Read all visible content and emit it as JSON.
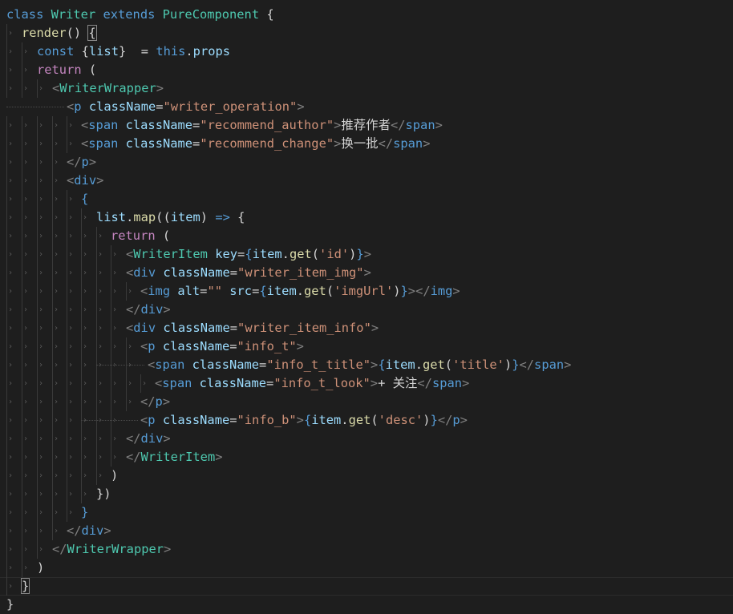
{
  "editor": {
    "theme_background": "#1e1e1e",
    "lines": [
      [
        [
          "kw",
          "class "
        ],
        [
          "cls",
          "Writer "
        ],
        [
          "kw",
          "extends "
        ],
        [
          "cls",
          "PureComponent "
        ],
        [
          "pun",
          "{"
        ]
      ],
      [
        [
          "fn",
          "render"
        ],
        [
          "pun",
          "() "
        ],
        [
          "pun",
          "{"
        ]
      ],
      [
        [
          "kw",
          "const "
        ],
        [
          "pun",
          "{"
        ],
        [
          "var",
          "list"
        ],
        [
          "pun",
          "}  = "
        ],
        [
          "kw",
          "this"
        ],
        [
          "pun",
          "."
        ],
        [
          "var",
          "props"
        ]
      ],
      [
        [
          "ctrl",
          "return "
        ],
        [
          "pun",
          "("
        ]
      ],
      [
        [
          "lt",
          "<"
        ],
        [
          "cls",
          "WriterWrapper"
        ],
        [
          "lt",
          ">"
        ]
      ],
      [
        [
          "lt",
          "<"
        ],
        [
          "tag",
          "p "
        ],
        [
          "attr",
          "className"
        ],
        [
          "pun",
          "="
        ],
        [
          "str",
          "\"writer_operation\""
        ],
        [
          "lt",
          ">"
        ]
      ],
      [
        [
          "lt",
          "<"
        ],
        [
          "tag",
          "span "
        ],
        [
          "attr",
          "className"
        ],
        [
          "pun",
          "="
        ],
        [
          "str",
          "\"recommend_author\""
        ],
        [
          "lt",
          ">"
        ],
        [
          "txt",
          "推荐作者"
        ],
        [
          "lt",
          "</"
        ],
        [
          "tag",
          "span"
        ],
        [
          "lt",
          ">"
        ]
      ],
      [
        [
          "lt",
          "<"
        ],
        [
          "tag",
          "span "
        ],
        [
          "attr",
          "className"
        ],
        [
          "pun",
          "="
        ],
        [
          "str",
          "\"recommend_change\""
        ],
        [
          "lt",
          ">"
        ],
        [
          "txt",
          "换一批"
        ],
        [
          "lt",
          "</"
        ],
        [
          "tag",
          "span"
        ],
        [
          "lt",
          ">"
        ]
      ],
      [
        [
          "lt",
          "</"
        ],
        [
          "tag",
          "p"
        ],
        [
          "lt",
          ">"
        ]
      ],
      [
        [
          "lt",
          "<"
        ],
        [
          "tag",
          "div"
        ],
        [
          "lt",
          ">"
        ]
      ],
      [
        [
          "brc",
          "{"
        ]
      ],
      [
        [
          "var",
          "list"
        ],
        [
          "pun",
          "."
        ],
        [
          "fn",
          "map"
        ],
        [
          "pun",
          "(("
        ],
        [
          "var",
          "item"
        ],
        [
          "pun",
          ") "
        ],
        [
          "kw",
          "=>"
        ],
        [
          "pun",
          " {"
        ]
      ],
      [
        [
          "ctrl",
          "return "
        ],
        [
          "pun",
          "("
        ]
      ],
      [
        [
          "lt",
          "<"
        ],
        [
          "cls",
          "WriterItem "
        ],
        [
          "attr",
          "key"
        ],
        [
          "pun",
          "="
        ],
        [
          "brc",
          "{"
        ],
        [
          "var",
          "item"
        ],
        [
          "pun",
          "."
        ],
        [
          "fn",
          "get"
        ],
        [
          "pun",
          "("
        ],
        [
          "str",
          "'id'"
        ],
        [
          "pun",
          ")"
        ],
        [
          "brc",
          "}"
        ],
        [
          "lt",
          ">"
        ]
      ],
      [
        [
          "lt",
          "<"
        ],
        [
          "tag",
          "div "
        ],
        [
          "attr",
          "className"
        ],
        [
          "pun",
          "="
        ],
        [
          "str",
          "\"writer_item_img\""
        ],
        [
          "lt",
          ">"
        ]
      ],
      [
        [
          "lt",
          "<"
        ],
        [
          "tag",
          "img "
        ],
        [
          "attr",
          "alt"
        ],
        [
          "pun",
          "="
        ],
        [
          "str",
          "\"\" "
        ],
        [
          "attr",
          "src"
        ],
        [
          "pun",
          "="
        ],
        [
          "brc",
          "{"
        ],
        [
          "var",
          "item"
        ],
        [
          "pun",
          "."
        ],
        [
          "fn",
          "get"
        ],
        [
          "pun",
          "("
        ],
        [
          "str",
          "'imgUrl'"
        ],
        [
          "pun",
          ")"
        ],
        [
          "brc",
          "}"
        ],
        [
          "lt",
          "></"
        ],
        [
          "tag",
          "img"
        ],
        [
          "lt",
          ">"
        ]
      ],
      [
        [
          "lt",
          "</"
        ],
        [
          "tag",
          "div"
        ],
        [
          "lt",
          ">"
        ]
      ],
      [
        [
          "lt",
          "<"
        ],
        [
          "tag",
          "div "
        ],
        [
          "attr",
          "className"
        ],
        [
          "pun",
          "="
        ],
        [
          "str",
          "\"writer_item_info\""
        ],
        [
          "lt",
          ">"
        ]
      ],
      [
        [
          "lt",
          "<"
        ],
        [
          "tag",
          "p "
        ],
        [
          "attr",
          "className"
        ],
        [
          "pun",
          "="
        ],
        [
          "str",
          "\"info_t\""
        ],
        [
          "lt",
          ">"
        ]
      ],
      [
        [
          "lt",
          "<"
        ],
        [
          "tag",
          "span "
        ],
        [
          "attr",
          "className"
        ],
        [
          "pun",
          "="
        ],
        [
          "str",
          "\"info_t_title\""
        ],
        [
          "lt",
          ">"
        ],
        [
          "brc",
          "{"
        ],
        [
          "var",
          "item"
        ],
        [
          "pun",
          "."
        ],
        [
          "fn",
          "get"
        ],
        [
          "pun",
          "("
        ],
        [
          "str",
          "'title'"
        ],
        [
          "pun",
          ")"
        ],
        [
          "brc",
          "}"
        ],
        [
          "lt",
          "</"
        ],
        [
          "tag",
          "span"
        ],
        [
          "lt",
          ">"
        ]
      ],
      [
        [
          "lt",
          "<"
        ],
        [
          "tag",
          "span "
        ],
        [
          "attr",
          "className"
        ],
        [
          "pun",
          "="
        ],
        [
          "str",
          "\"info_t_look\""
        ],
        [
          "lt",
          ">"
        ],
        [
          "txt",
          "+ 关注"
        ],
        [
          "lt",
          "</"
        ],
        [
          "tag",
          "span"
        ],
        [
          "lt",
          ">"
        ]
      ],
      [
        [
          "lt",
          "</"
        ],
        [
          "tag",
          "p"
        ],
        [
          "lt",
          ">"
        ]
      ],
      [
        [
          "lt",
          "<"
        ],
        [
          "tag",
          "p "
        ],
        [
          "attr",
          "className"
        ],
        [
          "pun",
          "="
        ],
        [
          "str",
          "\"info_b\""
        ],
        [
          "lt",
          ">"
        ],
        [
          "brc",
          "{"
        ],
        [
          "var",
          "item"
        ],
        [
          "pun",
          "."
        ],
        [
          "fn",
          "get"
        ],
        [
          "pun",
          "("
        ],
        [
          "str",
          "'desc'"
        ],
        [
          "pun",
          ")"
        ],
        [
          "brc",
          "}"
        ],
        [
          "lt",
          "</"
        ],
        [
          "tag",
          "p"
        ],
        [
          "lt",
          ">"
        ]
      ],
      [
        [
          "lt",
          "</"
        ],
        [
          "tag",
          "div"
        ],
        [
          "lt",
          ">"
        ]
      ],
      [
        [
          "lt",
          "</"
        ],
        [
          "cls",
          "WriterItem"
        ],
        [
          "lt",
          ">"
        ]
      ],
      [
        [
          "pun",
          ")"
        ]
      ],
      [
        [
          "pun",
          "})"
        ]
      ],
      [
        [
          "brc",
          "}"
        ]
      ],
      [
        [
          "lt",
          "</"
        ],
        [
          "tag",
          "div"
        ],
        [
          "lt",
          ">"
        ]
      ],
      [
        [
          "lt",
          "</"
        ],
        [
          "cls",
          "WriterWrapper"
        ],
        [
          "lt",
          ">"
        ]
      ],
      [
        [
          "pun",
          ")"
        ]
      ],
      [
        [
          "pun",
          "}"
        ]
      ],
      [
        [
          "pun",
          "}"
        ]
      ]
    ]
  }
}
